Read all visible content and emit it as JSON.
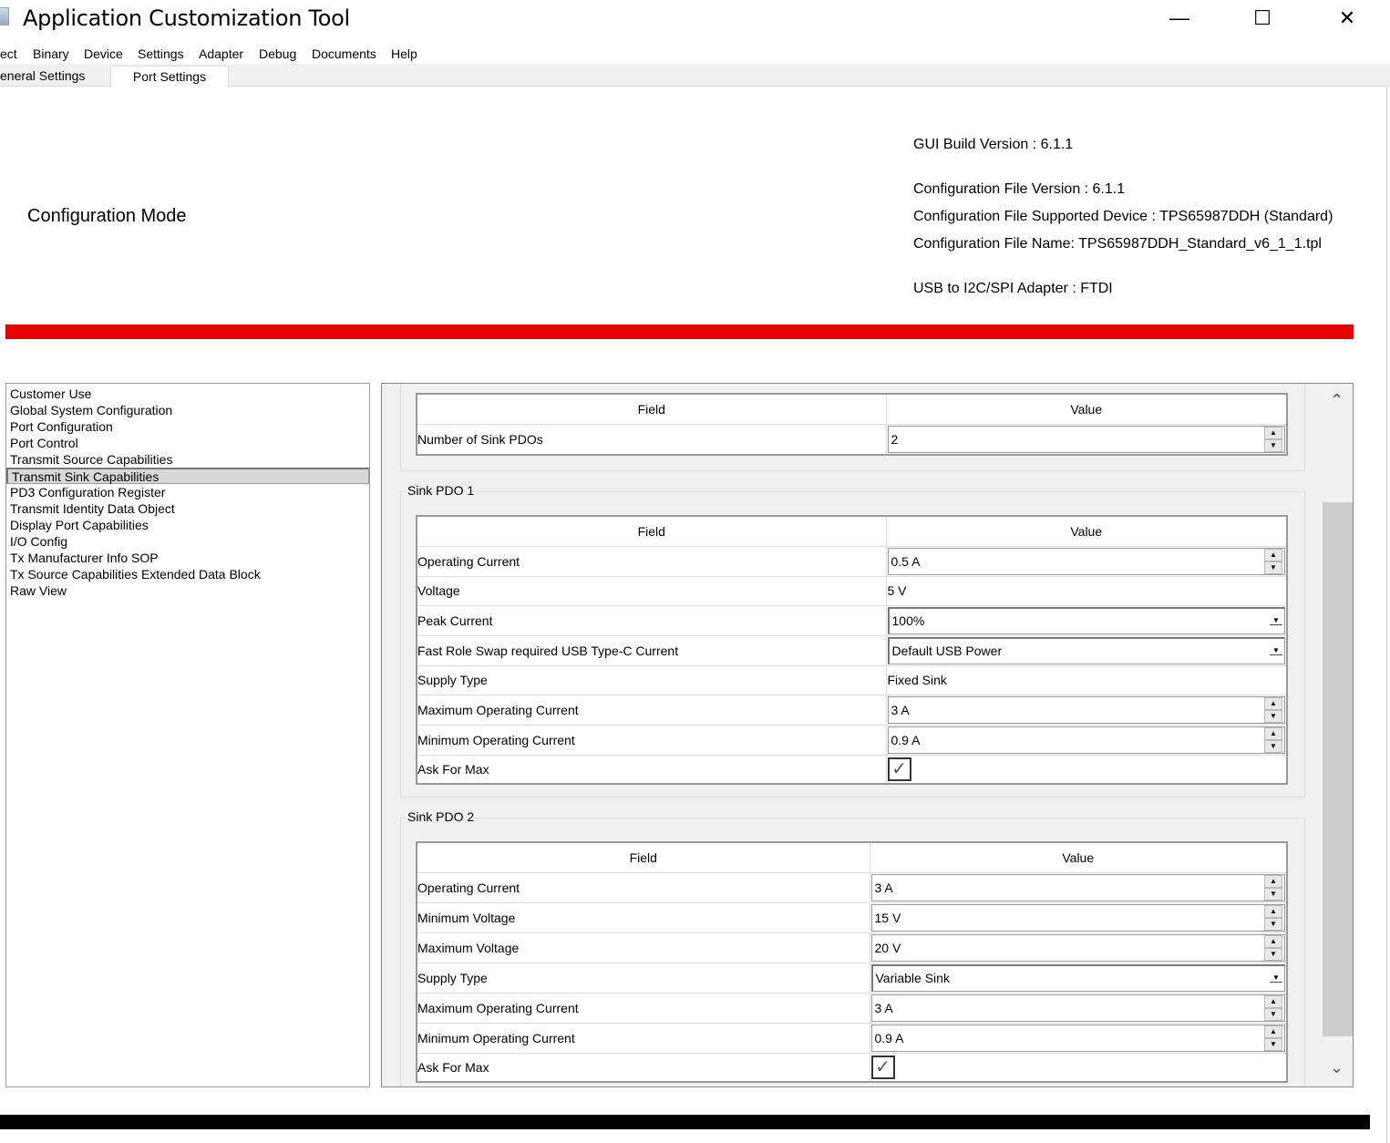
{
  "window": {
    "title": "Application Customization Tool",
    "minimize": "—",
    "maximize": "☐",
    "close": "✕"
  },
  "menu": [
    "ect",
    "Binary",
    "Device",
    "Settings",
    "Adapter",
    "Debug",
    "Documents",
    "Help"
  ],
  "tabs": [
    "eneral Settings",
    "Port Settings"
  ],
  "header": {
    "mode": "Configuration Mode",
    "gui_build": "GUI Build Version : 6.1.1",
    "config_version": "Configuration File Version : 6.1.1",
    "supported_device": "Configuration File Supported Device : TPS65987DDH (Standard)",
    "file_name": "Configuration File Name: TPS65987DDH_Standard_v6_1_1.tpl",
    "adapter": "USB to I2C/SPI Adapter : FTDI"
  },
  "colors": {
    "status_bar": "#e60000",
    "bottom_bar": "#000000"
  },
  "tree": {
    "selected": 4,
    "items": [
      "Customer Use",
      "Global System Configuration",
      "Port Configuration",
      "Port Control",
      "Transmit Source Capabilities",
      "Transmit Sink Capabilities",
      "PD3 Configuration Register",
      "Transmit Identity Data Object",
      "Display Port Capabilities",
      "I/O Config",
      "Tx Manufacturer Info SOP",
      "Tx Source Capabilities Extended Data Block",
      "Raw View"
    ]
  },
  "tables": [
    {
      "label": "",
      "field_header": "Field",
      "value_header": "Value",
      "rows": [
        {
          "field": "Number of Sink PDOs",
          "value": "2",
          "type": "spin"
        }
      ]
    },
    {
      "label": "Sink PDO 1",
      "field_header": "Field",
      "value_header": "Value",
      "rows": [
        {
          "field": "Operating Current",
          "value": "0.5 A",
          "type": "spin"
        },
        {
          "field": "Voltage",
          "value": "5 V",
          "type": "text"
        },
        {
          "field": "Peak Current",
          "value": "100%",
          "type": "select"
        },
        {
          "field": "Fast Role Swap required USB Type-C Current",
          "value": "Default USB Power",
          "type": "select"
        },
        {
          "field": "Supply Type",
          "value": "Fixed Sink",
          "type": "text"
        },
        {
          "field": "Maximum Operating Current",
          "value": "3 A",
          "type": "spin"
        },
        {
          "field": "Minimum Operating Current",
          "value": "0.9 A",
          "type": "spin"
        },
        {
          "field": "Ask For Max",
          "value": "✓",
          "type": "check"
        }
      ]
    },
    {
      "label": "Sink PDO 2",
      "field_header": "Field",
      "value_header": "Value",
      "rows": [
        {
          "field": "Operating Current",
          "value": "3 A",
          "type": "spin"
        },
        {
          "field": "Minimum Voltage",
          "value": "15 V",
          "type": "spin"
        },
        {
          "field": "Maximum Voltage",
          "value": "20 V",
          "type": "spin"
        },
        {
          "field": "Supply Type",
          "value": "Variable Sink",
          "type": "select"
        },
        {
          "field": "Maximum Operating Current",
          "value": "3 A",
          "type": "spin"
        },
        {
          "field": "Minimum Operating Current",
          "value": "0.9 A",
          "type": "spin"
        },
        {
          "field": "Ask For Max",
          "value": "✓",
          "type": "check"
        }
      ]
    }
  ],
  "scroll": {
    "up": "⌃",
    "down": "⌄"
  }
}
